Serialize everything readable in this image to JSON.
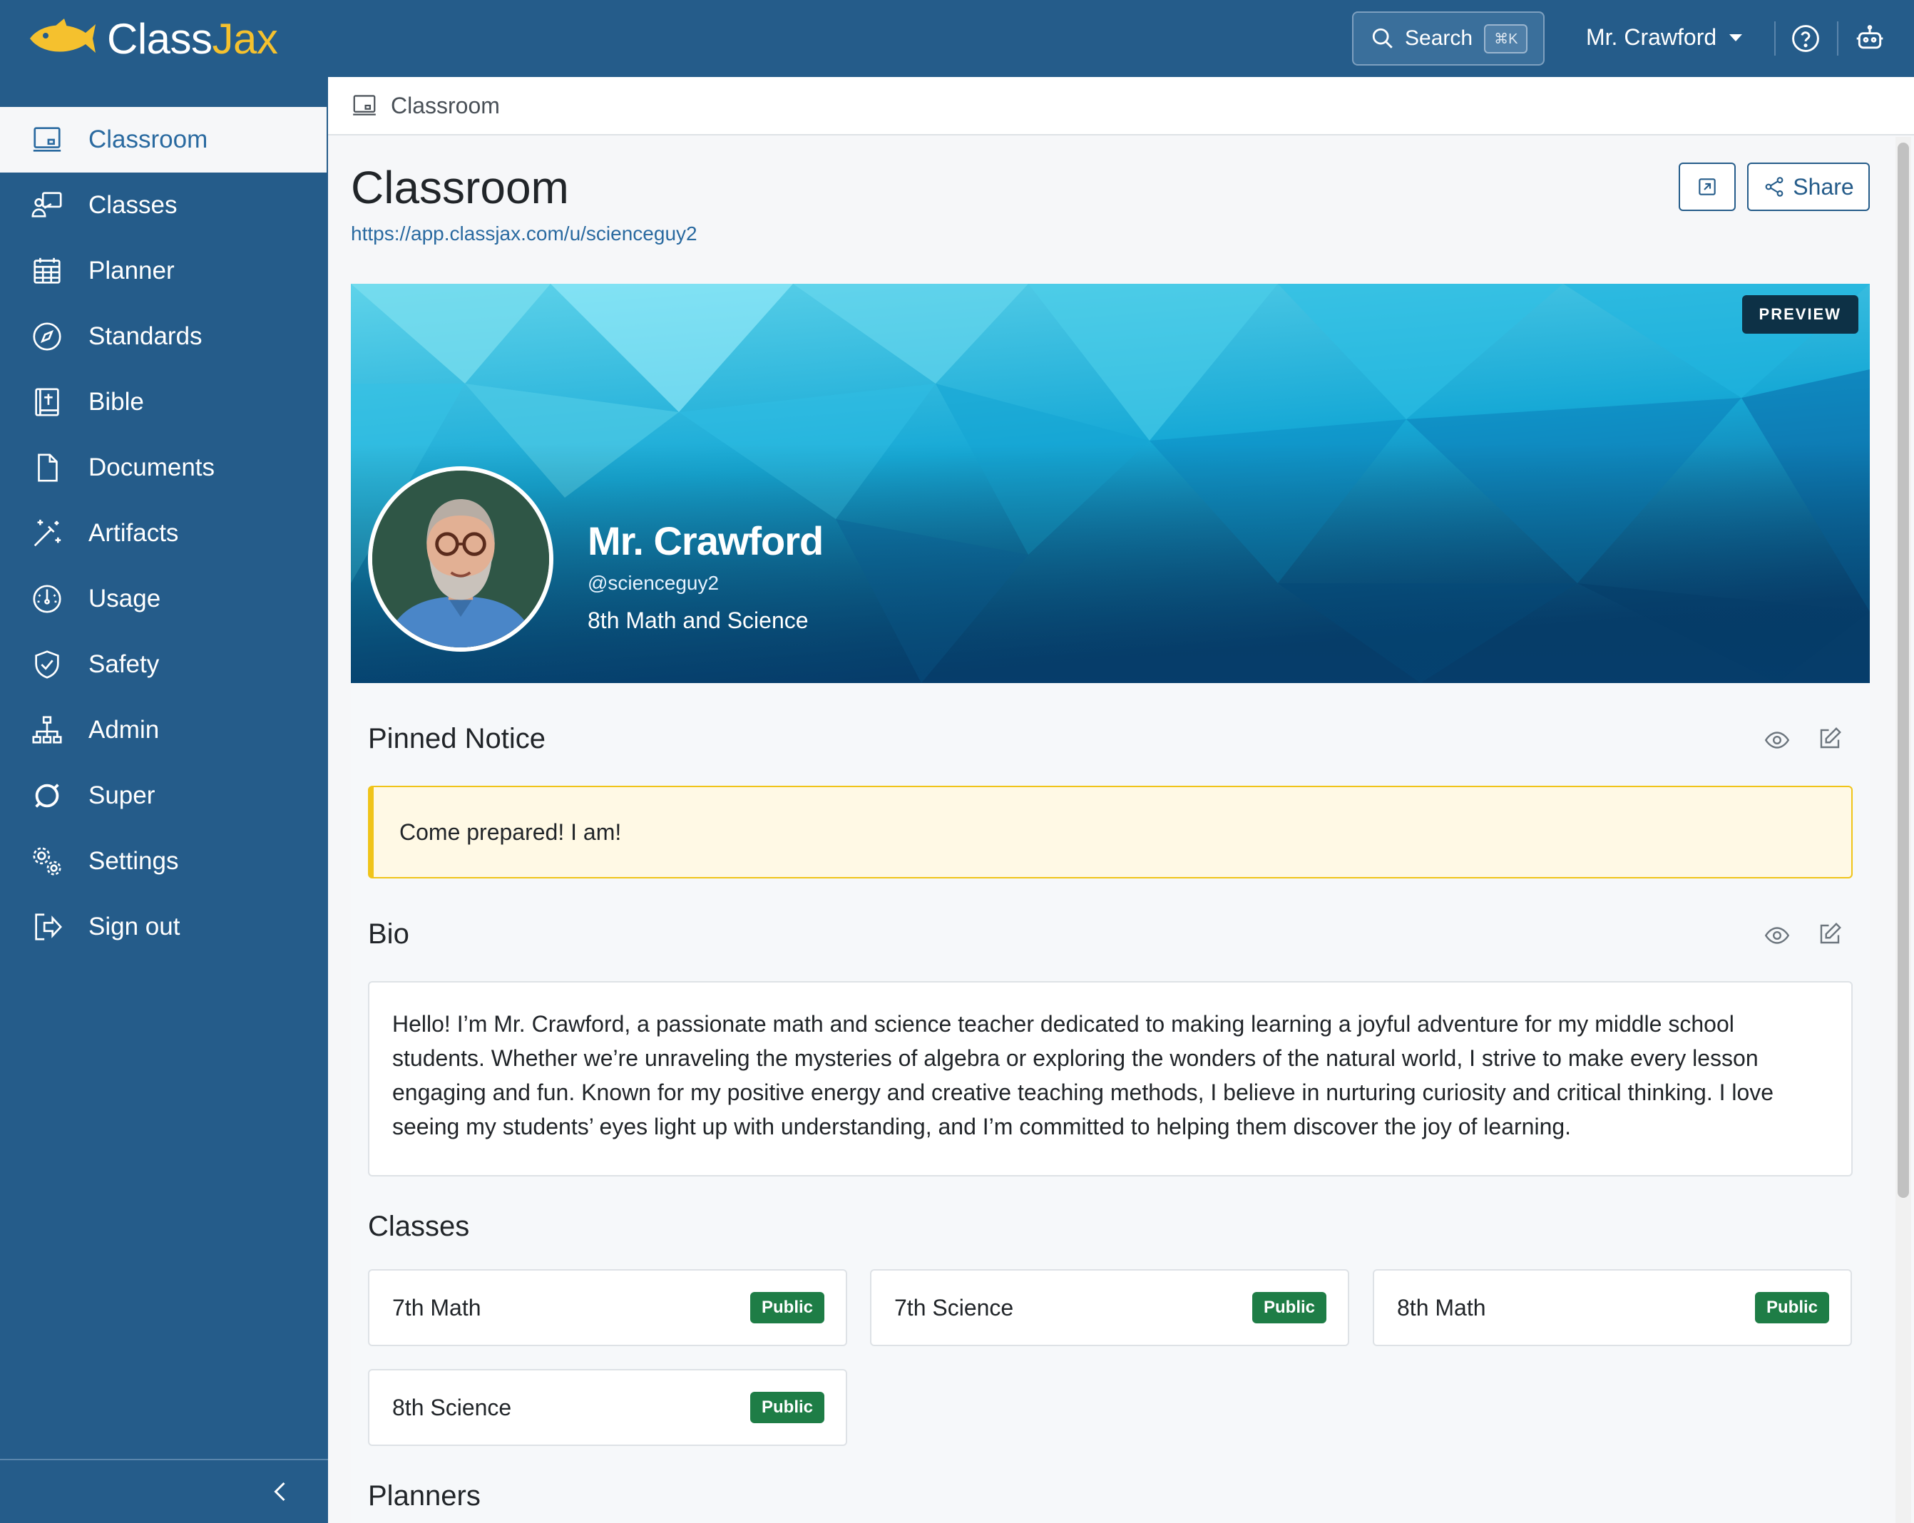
{
  "app": {
    "brand_first": "Class",
    "brand_second": "Jax",
    "brand_color": "#255c8a",
    "accent_color": "#f5c12e"
  },
  "topbar": {
    "search_label": "Search",
    "search_shortcut": "⌘K",
    "user_name": "Mr. Crawford",
    "icons": [
      "search-icon",
      "chevron-down-icon",
      "help-circle-icon",
      "robot-icon"
    ]
  },
  "sidebar": {
    "items": [
      {
        "label": "Classroom",
        "icon": "monitor-icon",
        "active": true
      },
      {
        "label": "Classes",
        "icon": "teacher-board-icon"
      },
      {
        "label": "Planner",
        "icon": "calendar-icon"
      },
      {
        "label": "Standards",
        "icon": "compass-icon"
      },
      {
        "label": "Bible",
        "icon": "bible-icon"
      },
      {
        "label": "Documents",
        "icon": "document-icon"
      },
      {
        "label": "Artifacts",
        "icon": "magic-wand-icon"
      },
      {
        "label": "Usage",
        "icon": "gauge-icon"
      },
      {
        "label": "Safety",
        "icon": "shield-check-icon"
      },
      {
        "label": "Admin",
        "icon": "org-chart-icon"
      },
      {
        "label": "Super",
        "icon": "ring-icon"
      },
      {
        "label": "Settings",
        "icon": "gears-icon"
      },
      {
        "label": "Sign out",
        "icon": "sign-out-icon"
      }
    ]
  },
  "breadcrumb": {
    "label": "Classroom"
  },
  "page": {
    "title": "Classroom",
    "url": "https://app.classjax.com/u/scienceguy2",
    "share_label": "Share"
  },
  "hero": {
    "badge": "PREVIEW",
    "name": "Mr. Crawford",
    "handle": "@scienceguy2",
    "subtitle": "8th Math and Science"
  },
  "pinned": {
    "title": "Pinned Notice",
    "text": "Come prepared! I am!"
  },
  "bio": {
    "title": "Bio",
    "text": "Hello! I’m Mr. Crawford, a passionate math and science teacher dedicated to making learning a joyful adventure for my middle school students. Whether we’re unraveling the mysteries of algebra or exploring the wonders of the natural world, I strive to make every lesson engaging and fun. Known for my positive energy and creative teaching methods, I believe in nurturing curiosity and critical thinking. I love seeing my students’ eyes light up with understanding, and I’m committed to helping them discover the joy of learning."
  },
  "classes": {
    "title": "Classes",
    "items": [
      {
        "name": "7th Math",
        "badge": "Public"
      },
      {
        "name": "7th Science",
        "badge": "Public"
      },
      {
        "name": "8th Math",
        "badge": "Public"
      },
      {
        "name": "8th Science",
        "badge": "Public"
      }
    ]
  },
  "planners": {
    "title": "Planners"
  }
}
